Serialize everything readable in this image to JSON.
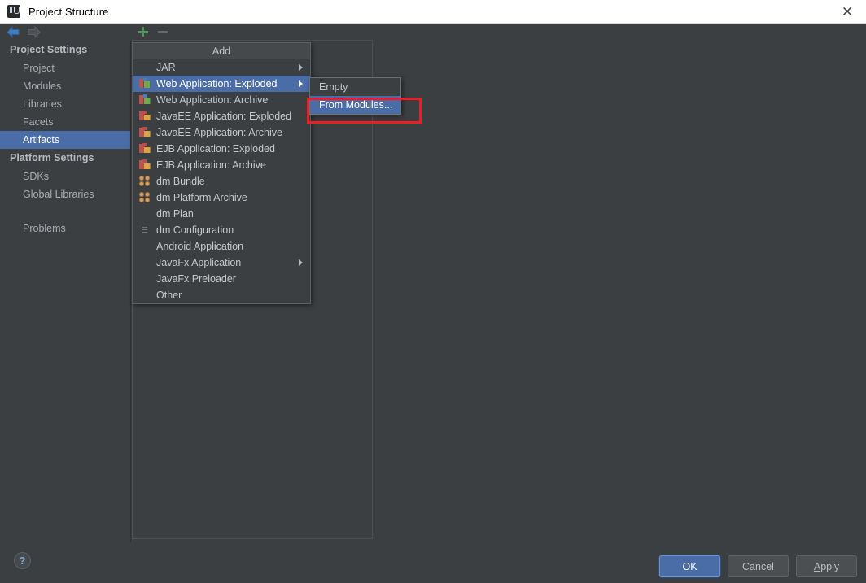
{
  "window": {
    "title": "Project Structure",
    "app_icon": "intellij-idea-icon",
    "close_label": "✕"
  },
  "nav": {
    "back_label": "back-arrow",
    "forward_label": "forward-arrow"
  },
  "sidebar": {
    "groups": [
      {
        "label": "Project Settings",
        "items": [
          {
            "label": "Project",
            "selected": false
          },
          {
            "label": "Modules",
            "selected": false
          },
          {
            "label": "Libraries",
            "selected": false
          },
          {
            "label": "Facets",
            "selected": false
          },
          {
            "label": "Artifacts",
            "selected": true
          }
        ]
      },
      {
        "label": "Platform Settings",
        "items": [
          {
            "label": "SDKs",
            "selected": false
          },
          {
            "label": "Global Libraries",
            "selected": false
          }
        ]
      }
    ],
    "problems": {
      "label": "Problems",
      "selected": false
    }
  },
  "toolbar": {
    "add_label": "+",
    "remove_label": "−"
  },
  "menu": {
    "header": "Add",
    "items": [
      {
        "label": "JAR",
        "icon": "diamond-icon",
        "has_submenu": true,
        "selected": false
      },
      {
        "label": "Web Application: Exploded",
        "icon": "web-app-icon",
        "has_submenu": true,
        "selected": true
      },
      {
        "label": "Web Application: Archive",
        "icon": "web-app-icon",
        "has_submenu": false,
        "selected": false
      },
      {
        "label": "JavaEE Application: Exploded",
        "icon": "javaee-app-icon",
        "has_submenu": false,
        "selected": false
      },
      {
        "label": "JavaEE Application: Archive",
        "icon": "javaee-app-icon",
        "has_submenu": false,
        "selected": false
      },
      {
        "label": "EJB Application: Exploded",
        "icon": "javaee-app-icon",
        "has_submenu": false,
        "selected": false
      },
      {
        "label": "EJB Application: Archive",
        "icon": "javaee-app-icon",
        "has_submenu": false,
        "selected": false
      },
      {
        "label": "dm Bundle",
        "icon": "dm-bundle-icon",
        "has_submenu": false,
        "selected": false
      },
      {
        "label": "dm Platform Archive",
        "icon": "dm-bundle-icon",
        "has_submenu": false,
        "selected": false
      },
      {
        "label": "dm Plan",
        "icon": "globe-icon",
        "has_submenu": false,
        "selected": false
      },
      {
        "label": "dm Configuration",
        "icon": "document-icon",
        "has_submenu": false,
        "selected": false
      },
      {
        "label": "Android Application",
        "icon": "diamond-icon",
        "has_submenu": false,
        "selected": false
      },
      {
        "label": "JavaFx Application",
        "icon": "diamond-icon",
        "has_submenu": true,
        "selected": false
      },
      {
        "label": "JavaFx Preloader",
        "icon": "diamond-icon",
        "has_submenu": false,
        "selected": false
      },
      {
        "label": "Other",
        "icon": "diamond-icon",
        "has_submenu": false,
        "selected": false
      }
    ]
  },
  "submenu": {
    "items": [
      {
        "label": "Empty",
        "selected": false
      },
      {
        "label": "From Modules...",
        "selected": true
      }
    ]
  },
  "annotation": {
    "color": "#ee1c25",
    "target": "From Modules..."
  },
  "footer": {
    "help_label": "?",
    "ok_label": "OK",
    "cancel_label": "Cancel",
    "apply_label_mnemonic": "A",
    "apply_label_rest": "pply"
  },
  "colors": {
    "window_bg": "#3c3f41",
    "titlebar_bg": "#ffffff",
    "selection_blue": "#4a6da7",
    "annotation_red": "#ee1c25",
    "add_green": "#4d9a51"
  }
}
